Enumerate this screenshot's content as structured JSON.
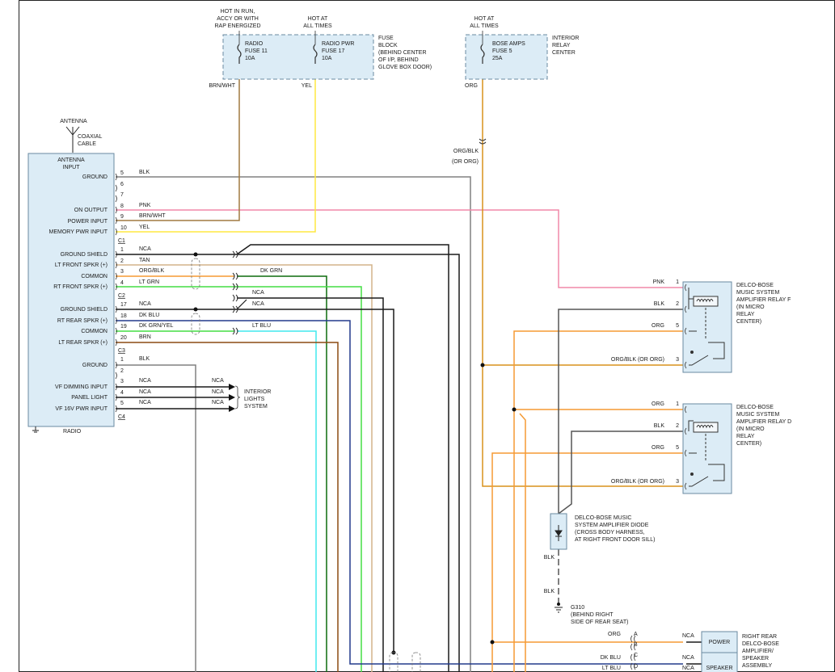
{
  "fuse_block": {
    "radio_hot": [
      "HOT IN RUN,",
      "ACCY OR WITH",
      "RAP ENERGIZED"
    ],
    "radio_pwr_hot": [
      "HOT AT",
      "ALL TIMES"
    ],
    "fuse11": [
      "RADIO",
      "FUSE 11",
      "10A"
    ],
    "fuse17": [
      "RADIO PWR",
      "FUSE 17",
      "10A"
    ],
    "description": [
      "FUSE",
      "BLOCK",
      "(BEHIND CENTER",
      "OF I/P, BEHIND",
      "GLOVE BOX DOOR)"
    ]
  },
  "relay_center": {
    "hot": [
      "HOT AT",
      "ALL TIMES"
    ],
    "fuse5": [
      "BOSE AMPS",
      "FUSE 5",
      "25A"
    ],
    "description": [
      "INTERIOR",
      "RELAY",
      "CENTER"
    ]
  },
  "antenna": {
    "label": "ANTENNA",
    "cable": [
      "COAXIAL",
      "CABLE"
    ]
  },
  "radio": {
    "name": "RADIO",
    "pins": [
      "ANTENNA",
      "INPUT",
      "GROUND",
      "ON OUTPUT",
      "POWER INPUT",
      "MEMORY PWR INPUT",
      "GROUND SHIELD",
      "LT FRONT SPKR (+)",
      "COMMON",
      "RT FRONT SPKR (+)",
      "GROUND SHIELD",
      "RT REAR SPKR (+)",
      "COMMON",
      "LT REAR SPKR (+)",
      "GROUND",
      "VF DIMMING INPUT",
      "PANEL LIGHT",
      "VF 16V PWR INPUT"
    ],
    "connectors": [
      "C1",
      "C2",
      "C3",
      "C4"
    ]
  },
  "wires": {
    "top": [
      {
        "pin": "5",
        "color": "BLK"
      },
      {
        "pin": "6",
        "color": ""
      },
      {
        "pin": "7",
        "color": ""
      },
      {
        "pin": "8",
        "color": "PNK"
      },
      {
        "pin": "9",
        "color": "BRN/WHT"
      },
      {
        "pin": "10",
        "color": "YEL"
      }
    ],
    "c1": [
      {
        "pin": "1",
        "color": "NCA"
      },
      {
        "pin": "2",
        "color": "TAN"
      },
      {
        "pin": "3",
        "color": "ORG/BLK"
      },
      {
        "pin": "4",
        "color": "LT GRN"
      }
    ],
    "c2": [
      {
        "pin": "17",
        "color": "NCA"
      },
      {
        "pin": "18",
        "color": "DK BLU"
      },
      {
        "pin": "19",
        "color": "DK GRN/YEL"
      },
      {
        "pin": "20",
        "color": "BRN"
      }
    ],
    "c3": [
      {
        "pin": "1",
        "color": "BLK"
      },
      {
        "pin": "2",
        "color": ""
      },
      {
        "pin": "3",
        "color": "NCA"
      },
      {
        "pin": "4",
        "color": "NCA"
      },
      {
        "pin": "5",
        "color": "NCA"
      }
    ],
    "interior_nca": [
      "NCA",
      "NCA",
      "NCA"
    ],
    "interior_lights": [
      "INTERIOR",
      "LIGHTS",
      "SYSTEM"
    ],
    "mid": {
      "dk_grn": "DK GRN",
      "nca1": "NCA",
      "nca2": "NCA",
      "lt_blu": "LT BLU"
    },
    "fuse_out": {
      "brn_wht": "BRN/WHT",
      "yel": "YEL",
      "org": "ORG",
      "org_blk": [
        "ORG/BLK",
        "(OR ORG)"
      ]
    }
  },
  "relay_f": {
    "desc": [
      "DELCO-BOSE",
      "MUSIC SYSTEM",
      "AMPLIFIER RELAY F",
      "(IN MICRO",
      "RELAY",
      "CENTER)"
    ],
    "pins": [
      {
        "n": "1",
        "color": "PNK"
      },
      {
        "n": "2",
        "color": "BLK"
      },
      {
        "n": "5",
        "color": "ORG"
      },
      {
        "n": "3",
        "color": "ORG/BLK (OR ORG)"
      }
    ]
  },
  "relay_d": {
    "desc": [
      "DELCO-BOSE",
      "MUSIC SYSTEM",
      "AMPLIFIER RELAY D",
      "(IN MICRO",
      "RELAY",
      "CENTER)"
    ],
    "pins": [
      {
        "n": "1",
        "color": "ORG"
      },
      {
        "n": "2",
        "color": "BLK"
      },
      {
        "n": "5",
        "color": "ORG"
      },
      {
        "n": "3",
        "color": "ORG/BLK (OR ORG)"
      }
    ]
  },
  "diode": {
    "desc": [
      "DELCO-BOSE MUSIC",
      "SYSTEM AMPLIFIER DIODE",
      "(CROSS BODY HARNESS,",
      "AT RIGHT FRONT DOOR SILL)"
    ],
    "blk1": "BLK",
    "blk2": "BLK"
  },
  "ground": {
    "desc": [
      "G310",
      "(BEHIND RIGHT",
      "SIDE OF REAR SEAT)"
    ]
  },
  "speaker": {
    "power": "POWER",
    "speaker": "SPEAKER",
    "desc": [
      "RIGHT REAR",
      "DELCO-BOSE",
      "AMPLIFIER/",
      "SPEAKER",
      "ASSEMBLY"
    ],
    "pins": [
      {
        "n": "A",
        "color": "ORG",
        "nca": "NCA"
      },
      {
        "n": "B",
        "color": "",
        "nca": ""
      },
      {
        "n": "C",
        "color": "DK BLU",
        "nca": "NCA"
      },
      {
        "n": "D",
        "color": "LT BLU",
        "nca": "NCA"
      }
    ]
  },
  "colors": {
    "BLK": "#1a1a1a",
    "GRY": "#808080",
    "PNK": "#f088a8",
    "BRNWHT": "#a07a40",
    "YEL": "#ffe840",
    "TAN": "#d4b48a",
    "ORG": "#f59a33",
    "LTGRN": "#44dd44",
    "DKGRN": "#0d6b0d",
    "DKBLU": "#223a8c",
    "CYAN": "#40e8ee",
    "BRN": "#8b4a12",
    "AMBER": "#d8921c"
  }
}
